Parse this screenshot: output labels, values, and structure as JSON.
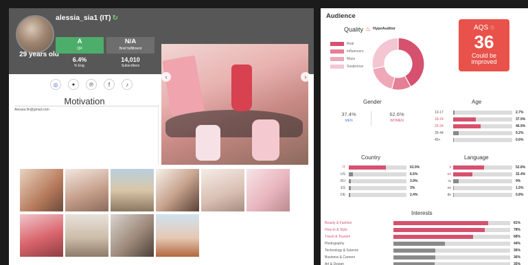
{
  "profile": {
    "username": "alessia_sia1 (IT)",
    "age": "29 years old",
    "qr": {
      "value": "A",
      "label": "QR"
    },
    "brief": {
      "value": "N/A",
      "label": "Brief fulfillment"
    },
    "engagement": {
      "value": "6.4%",
      "label": "% Eng."
    },
    "subscribers": {
      "value": "14,010",
      "label": "Subscribers"
    }
  },
  "socials": [
    "instagram-icon",
    "twitter-icon",
    "pinterest-icon",
    "facebook-icon",
    "tiktok-icon"
  ],
  "motivation": {
    "title": "Motivation",
    "email": "Alessia.ifn@gmail.com"
  },
  "audience": {
    "title": "Audience",
    "quality": {
      "label": "Quality",
      "brand": "HypeAuditor",
      "legend": [
        {
          "name": "Real",
          "color": "#d6516e",
          "value": 42
        },
        {
          "name": "Influencers",
          "color": "#e47f95",
          "value": 12
        },
        {
          "name": "Mass",
          "color": "#eea8b8",
          "value": 18
        },
        {
          "name": "Suspicious",
          "color": "#f3c6d1",
          "value": 28
        }
      ]
    },
    "aqs": {
      "label": "AQS",
      "value": "36",
      "status": "Could be improved",
      "color": "#e8524a"
    },
    "gender": {
      "title": "Gender",
      "men": {
        "value": "37.4%",
        "label": "MEN"
      },
      "women": {
        "value": "62.6%",
        "label": "WOMEN"
      }
    },
    "age": {
      "title": "Age",
      "rows": [
        {
          "label": "13-17",
          "value": 2.7,
          "pct": "2.7%",
          "highlight": false
        },
        {
          "label": "18-24",
          "value": 37.9,
          "pct": "37.9%",
          "highlight": true
        },
        {
          "label": "25-34",
          "value": 46.9,
          "pct": "46.9%",
          "highlight": true
        },
        {
          "label": "35-44",
          "value": 9.2,
          "pct": "9.2%",
          "highlight": false
        },
        {
          "label": "45+",
          "value": 0.6,
          "pct": "0.6%",
          "highlight": false
        }
      ]
    },
    "country": {
      "title": "Country",
      "rows": [
        {
          "label": "IT",
          "value": 63.9,
          "pct": "63.9%",
          "highlight": true
        },
        {
          "label": "US",
          "value": 6.6,
          "pct": "6.6%",
          "highlight": false
        },
        {
          "label": "RU",
          "value": 3.9,
          "pct": "3.9%",
          "highlight": false
        },
        {
          "label": "ES",
          "value": 3,
          "pct": "3%",
          "highlight": false
        },
        {
          "label": "DE",
          "value": 2.4,
          "pct": "2.4%",
          "highlight": false
        }
      ]
    },
    "language": {
      "title": "Language",
      "rows": [
        {
          "label": "it",
          "value": 52.8,
          "pct": "52.8%",
          "highlight": true
        },
        {
          "label": "en",
          "value": 32.4,
          "pct": "32.4%",
          "highlight": true
        },
        {
          "label": "ru",
          "value": 9,
          "pct": "9%",
          "highlight": false
        },
        {
          "label": "es",
          "value": 1.5,
          "pct": "1.5%",
          "highlight": false
        },
        {
          "label": "de",
          "value": 0.8,
          "pct": "0.8%",
          "highlight": false
        }
      ]
    },
    "interests": {
      "title": "Interests",
      "rows": [
        {
          "label": "Beauty & Fashion",
          "value": 81,
          "pct": "81%",
          "highlight": true
        },
        {
          "label": "How-to & Style",
          "value": 78,
          "pct": "78%",
          "highlight": true
        },
        {
          "label": "Travel & Tourism",
          "value": 68,
          "pct": "68%",
          "highlight": true
        },
        {
          "label": "Photography",
          "value": 44,
          "pct": "44%",
          "highlight": false
        },
        {
          "label": "Technology & Science",
          "value": 36,
          "pct": "36%",
          "highlight": false
        },
        {
          "label": "Business & Careers",
          "value": 36,
          "pct": "36%",
          "highlight": false
        },
        {
          "label": "Art & Design",
          "value": 35,
          "pct": "35%",
          "highlight": false
        }
      ]
    }
  },
  "colors": {
    "accent": "#d6516e",
    "neutral_bar": "#8a8a8a",
    "track": "#dcdcdc",
    "men": "#4f86d6"
  }
}
